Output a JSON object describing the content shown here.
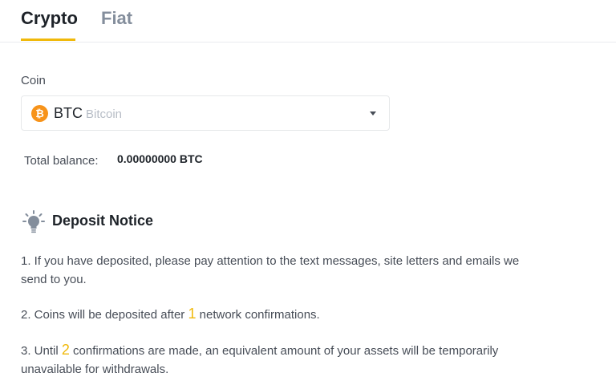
{
  "tabs": {
    "crypto": "Crypto",
    "fiat": "Fiat"
  },
  "coin": {
    "label": "Coin",
    "icon_glyph": "₿",
    "icon_name": "bitcoin-icon",
    "symbol": "BTC",
    "name": "Bitcoin"
  },
  "balance": {
    "label": "Total balance:",
    "value": "0.00000000 BTC"
  },
  "notice": {
    "title": "Deposit Notice",
    "icon_name": "lightbulb-icon",
    "item1": "1. If you have deposited, please pay attention to the text messages, site letters and emails we send to you.",
    "item2_prefix": "2. Coins will be deposited after",
    "item2_number": "1",
    "item2_suffix": "network confirmations.",
    "item3_prefix": "3. Until",
    "item3_number": "2",
    "item3_suffix": "confirmations are made, an equivalent amount of your assets will be temporarily unavailable for withdrawals."
  },
  "colors": {
    "accent": "#f0b90b",
    "bitcoin": "#f7931a",
    "text_primary": "#1e2329",
    "text_secondary": "#474d57",
    "text_muted": "#848e9c"
  }
}
